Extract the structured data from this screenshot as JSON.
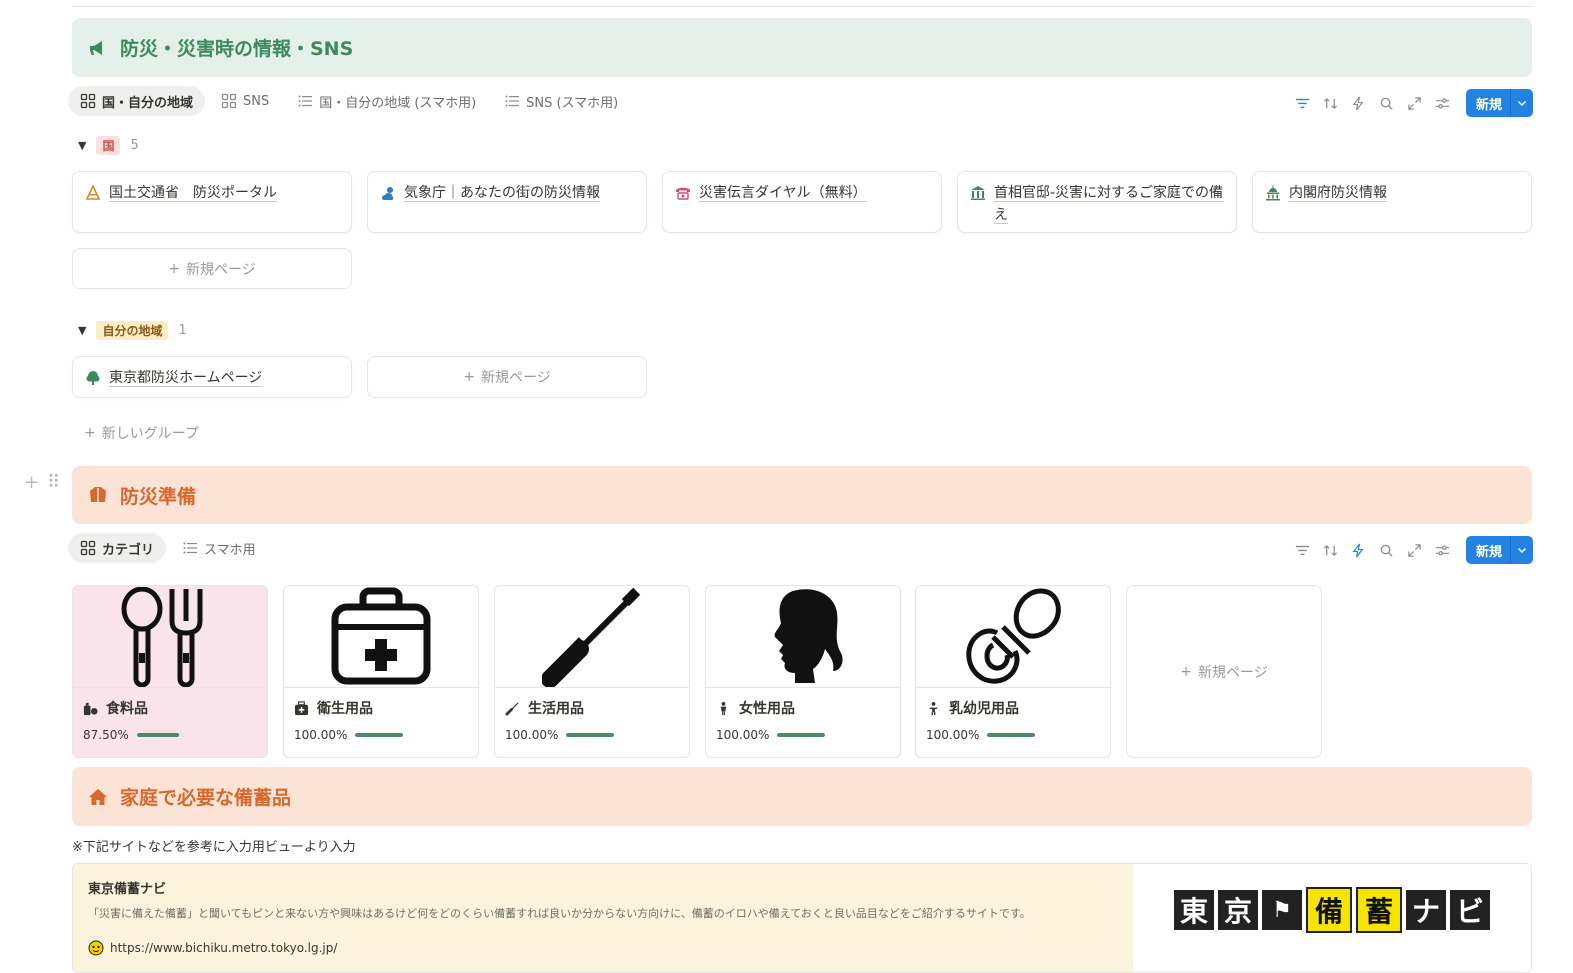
{
  "section1": {
    "title": "防災・災害時の情報・SNS",
    "tabs": [
      "国・自分の地域",
      "SNS",
      "国・自分の地域 (スマホ用)",
      "SNS (スマホ用)"
    ],
    "new_label": "新規",
    "groups": [
      {
        "label": "国",
        "count": "5",
        "cards": [
          "国土交通省　防災ポータル",
          "気象庁｜あなたの街の防災情報",
          "災害伝言ダイヤル（無料）",
          "首相官邸-災害に対するご家庭での備え",
          "内閣府防災情報"
        ]
      },
      {
        "label": "自分の地域",
        "count": "1",
        "cards": [
          "東京都防災ホームページ"
        ]
      }
    ],
    "new_page": "新規ページ",
    "new_group": "新しいグループ"
  },
  "section2": {
    "title": "防災準備",
    "tabs": [
      "カテゴリ",
      "スマホ用"
    ],
    "new_label": "新規",
    "items": [
      {
        "name": "食料品",
        "percent": "87.50%",
        "progress": 0.875
      },
      {
        "name": "衛生用品",
        "percent": "100.00%",
        "progress": 1.0
      },
      {
        "name": "生活用品",
        "percent": "100.00%",
        "progress": 1.0
      },
      {
        "name": "女性用品",
        "percent": "100.00%",
        "progress": 1.0
      },
      {
        "name": "乳幼児用品",
        "percent": "100.00%",
        "progress": 1.0
      }
    ],
    "new_page": "新規ページ"
  },
  "section3": {
    "title": "家庭で必要な備蓄品",
    "note": "※下記サイトなどを参考に入力用ビューより入力",
    "bookmark": {
      "title": "東京備蓄ナビ",
      "description": "「災害に備えた備蓄」と聞いてもピンと来ない方や興味はあるけど何をどのくらい備蓄すれば良いか分からない方向けに、備蓄のイロハや備えておくと良い品目などをご紹介するサイトです。",
      "url": "https://www.bichiku.metro.tokyo.lg.jp/",
      "logo_chars": [
        "東",
        "京",
        "⚑",
        "備",
        "蓄",
        "ナ",
        "ビ"
      ]
    }
  },
  "colors": {
    "accent": "#2383e2",
    "green_title": "#3c8a5e",
    "orange_title": "#d8682c",
    "progress": "#4d8a6a"
  }
}
